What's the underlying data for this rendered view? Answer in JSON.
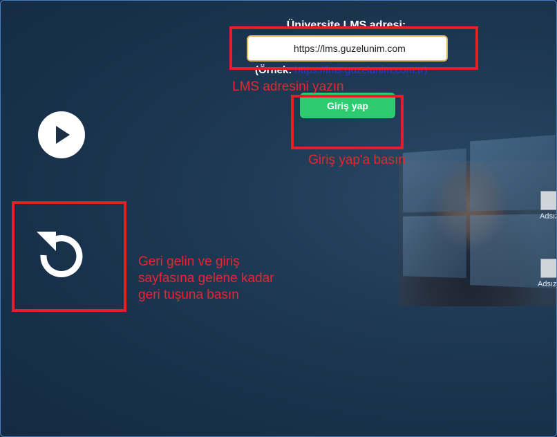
{
  "form": {
    "label": "Üniversite LMS adresi:",
    "url_value": "https://lms.guzelunim.com",
    "example_prefix": "(Örnek: ",
    "example_link": "https://lms.guzelunim.com.tr)",
    "login_button": "Giriş yap"
  },
  "controls": {
    "play_icon": "play-icon",
    "back_icon": "refresh-back-icon"
  },
  "annotations": {
    "enter_url": "LMS adresini yazın",
    "press_login": "Giriş yap'a basın",
    "back_line1": "Geri gelin ve giriş",
    "back_line2": "sayfasına gelene kadar",
    "back_line3": "geri tuşuna basın",
    "color": "#e32027"
  },
  "desktop": {
    "icon1_label": "Adsız",
    "icon2_label": "Adsız"
  }
}
